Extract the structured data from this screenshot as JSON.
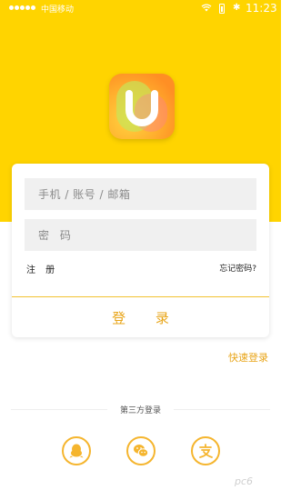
{
  "status_bar": {
    "carrier": "中国移动",
    "time": "11:23"
  },
  "login_form": {
    "account_placeholder": "手机 / 账号 / 邮箱",
    "password_placeholder": "密 码",
    "register_label": "注 册",
    "forgot_label": "忘记密码?",
    "submit_label": "登 录"
  },
  "quick_login_label": "快速登录",
  "third_party": {
    "label": "第三方登录",
    "options": [
      {
        "name": "QQ",
        "icon": "qq-icon"
      },
      {
        "name": "WeChat",
        "icon": "wechat-icon"
      },
      {
        "name": "Alipay",
        "icon": "alipay-icon"
      }
    ]
  },
  "watermark": "pc6",
  "colors": {
    "brand_yellow": "#ffd400",
    "accent_orange": "#e8a519",
    "icon_ring": "#f5b52e"
  }
}
